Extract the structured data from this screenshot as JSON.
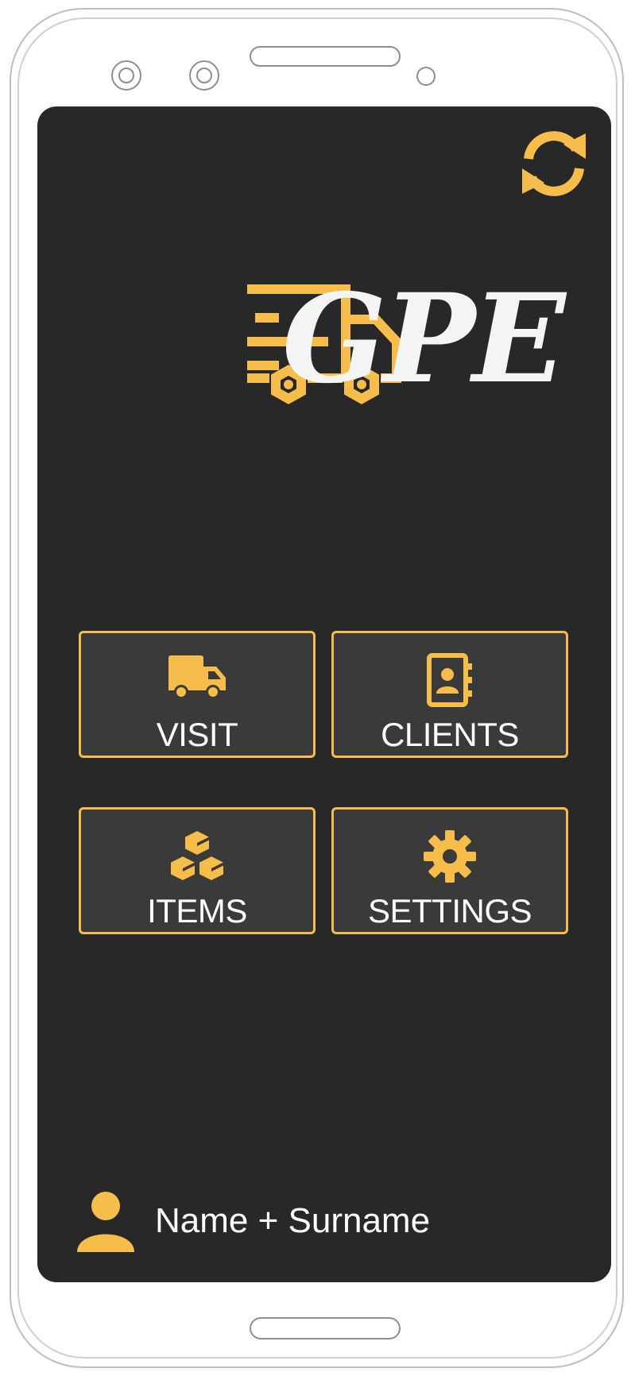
{
  "app": {
    "logo_text": "GPE"
  },
  "menu": {
    "visit": {
      "label": "VISIT",
      "icon": "truck-icon"
    },
    "clients": {
      "label": "CLIENTS",
      "icon": "address-book-icon"
    },
    "items": {
      "label": "ITEMS",
      "icon": "cubes-icon"
    },
    "settings": {
      "label": "SETTINGS",
      "icon": "gear-icon"
    }
  },
  "toolbar": {
    "sync_icon": "sync-icon"
  },
  "user": {
    "name": "Name + Surname",
    "icon": "user-icon"
  },
  "colors": {
    "accent": "#f7bd4a",
    "screen_background": "#282828",
    "button_background": "#3a3a3a",
    "text": "#ffffff",
    "logo_text": "#f4f4f4"
  }
}
